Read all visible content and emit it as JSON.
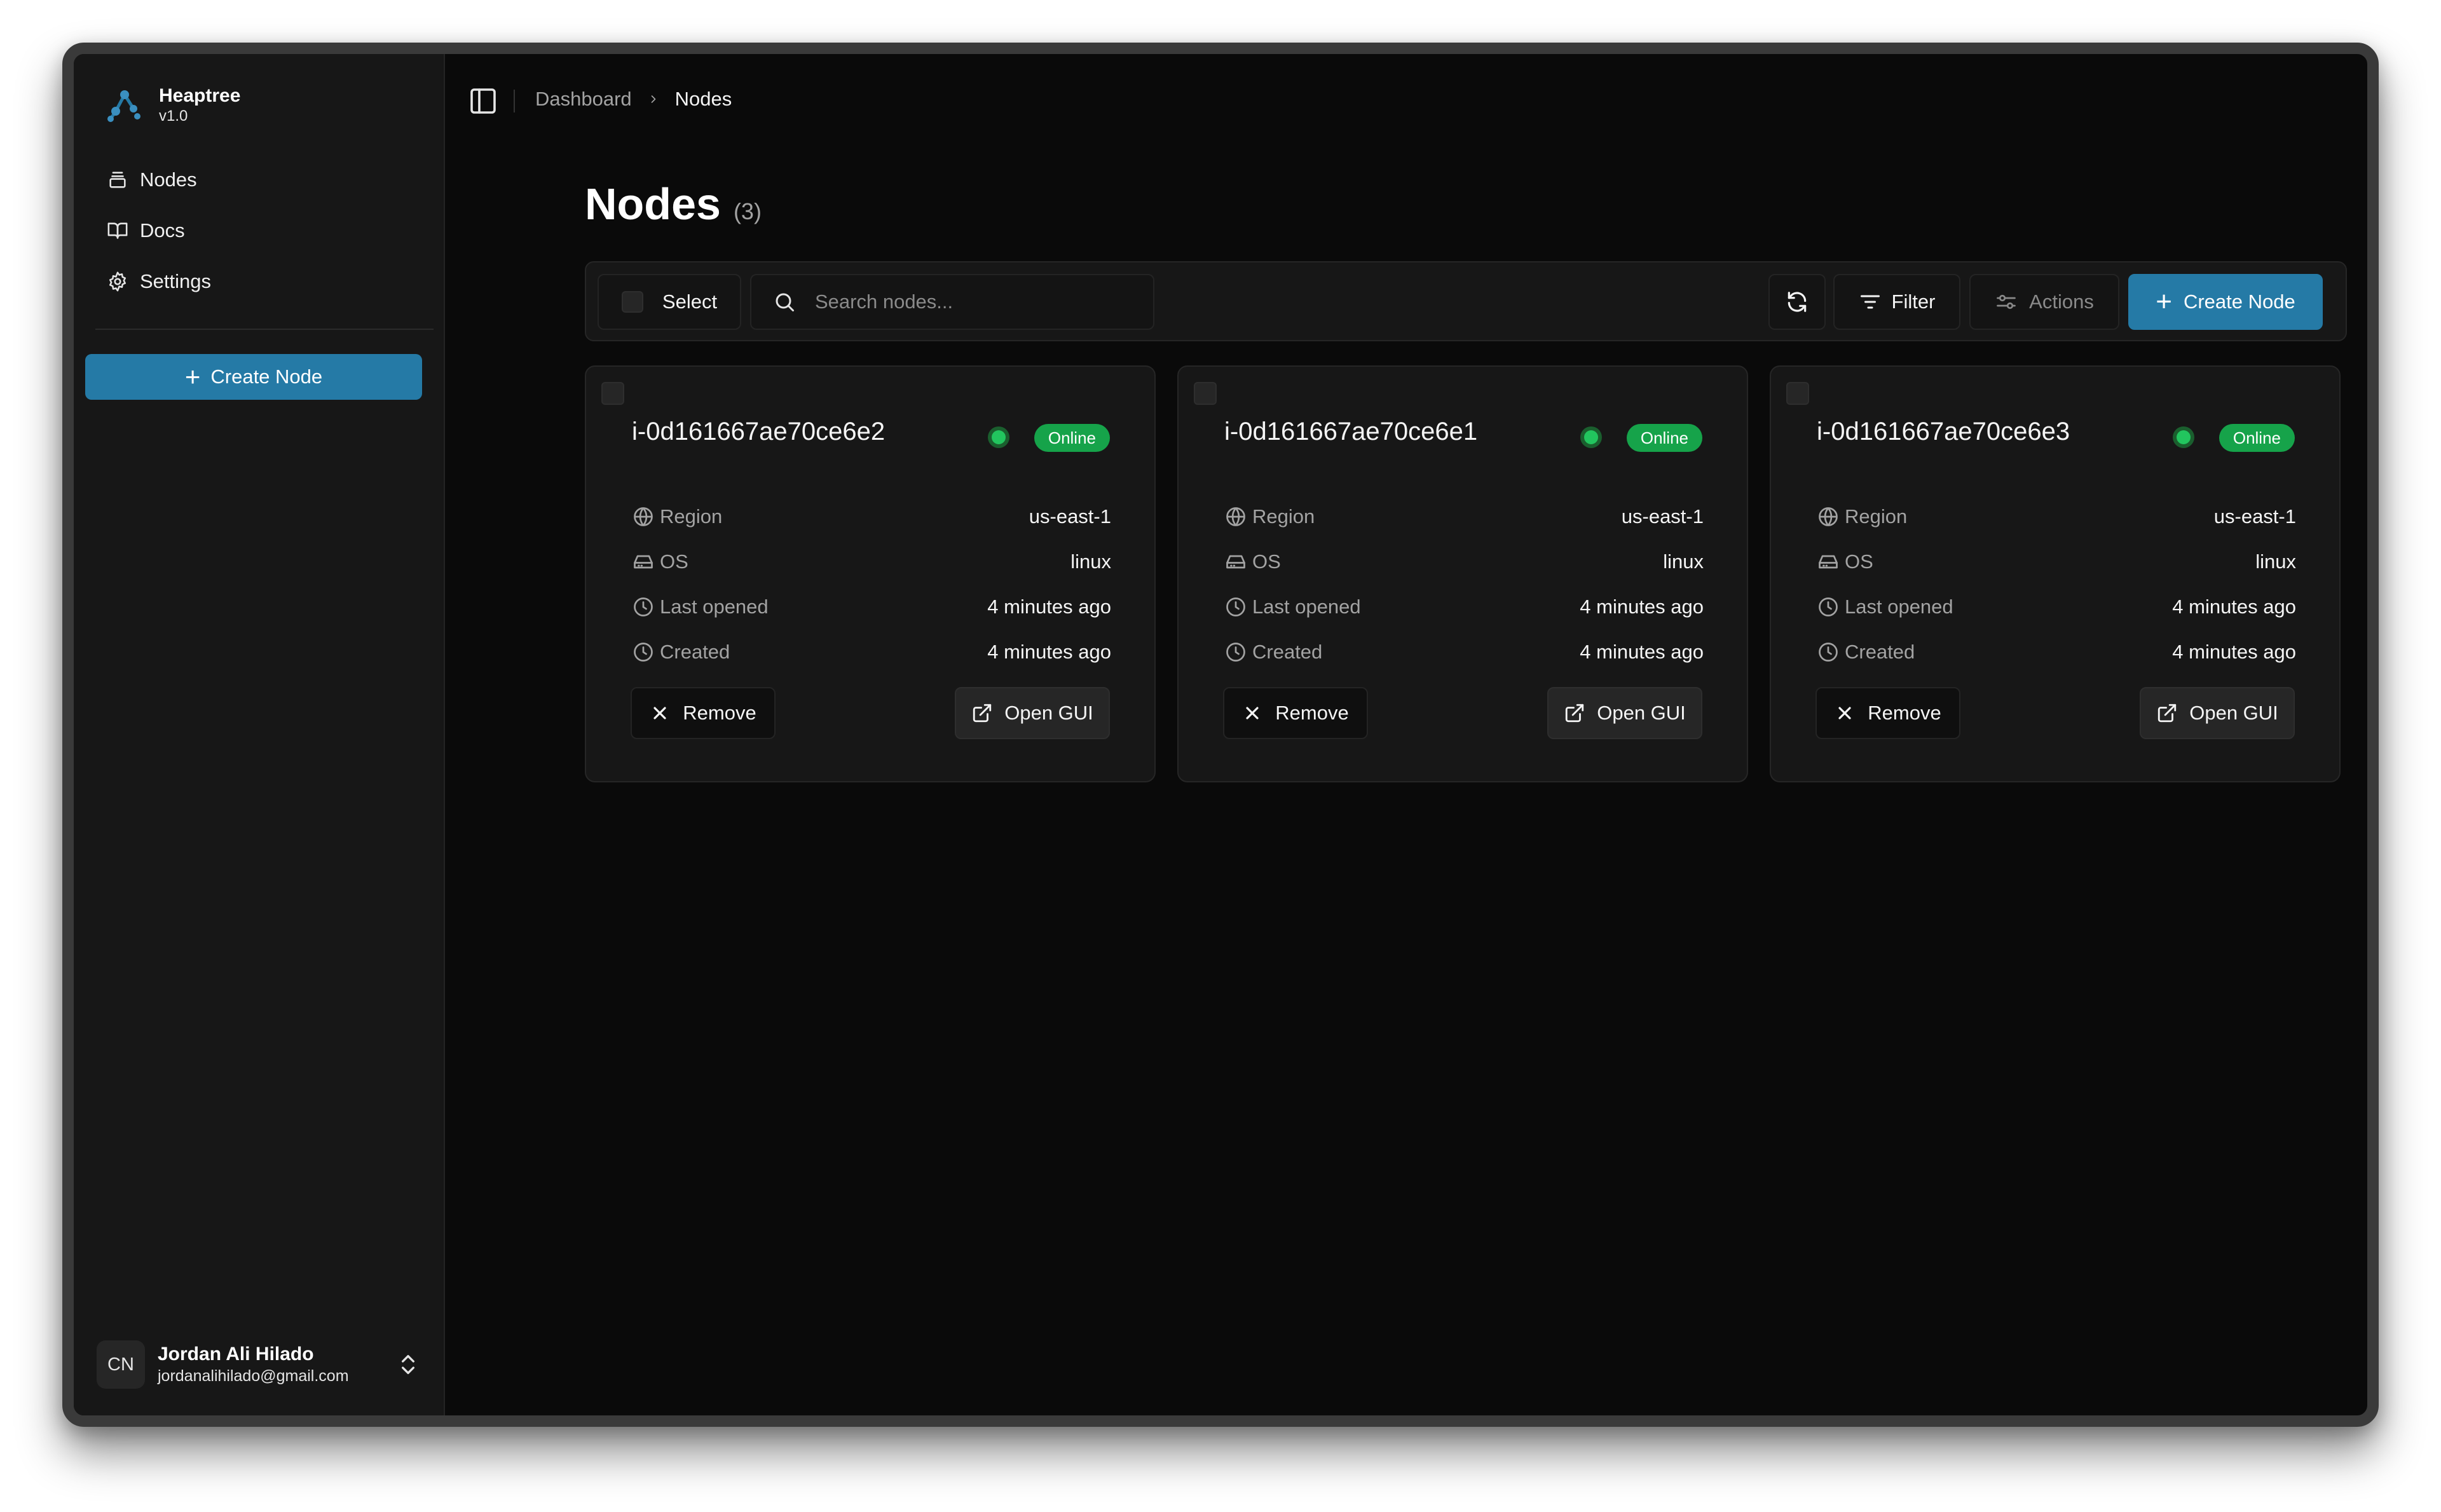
{
  "app": {
    "name": "Heaptree",
    "version": "v1.0"
  },
  "sidebar": {
    "items": [
      {
        "label": "Nodes",
        "icon": "server-icon"
      },
      {
        "label": "Docs",
        "icon": "book-icon"
      },
      {
        "label": "Settings",
        "icon": "gear-icon"
      }
    ],
    "create_label": "Create Node"
  },
  "user": {
    "initials": "CN",
    "name": "Jordan Ali Hilado",
    "email": "jordanalihilado@gmail.com"
  },
  "breadcrumb": {
    "parent": "Dashboard",
    "current": "Nodes"
  },
  "page": {
    "title": "Nodes",
    "count": "(3)"
  },
  "toolbar": {
    "select_label": "Select",
    "search_placeholder": "Search nodes...",
    "filter_label": "Filter",
    "actions_label": "Actions",
    "create_label": "Create Node"
  },
  "labels": {
    "region": "Region",
    "os": "OS",
    "last_opened": "Last opened",
    "created": "Created"
  },
  "nodes": [
    {
      "id": "i-0d161667ae70ce6e2",
      "status": "Online",
      "region": "us-east-1",
      "os": "linux",
      "last_opened": "4 minutes ago",
      "created": "4 minutes ago",
      "remove_label": "Remove",
      "open_label": "Open GUI"
    },
    {
      "id": "i-0d161667ae70ce6e1",
      "status": "Online",
      "region": "us-east-1",
      "os": "linux",
      "last_opened": "4 minutes ago",
      "created": "4 minutes ago",
      "remove_label": "Remove",
      "open_label": "Open GUI"
    },
    {
      "id": "i-0d161667ae70ce6e3",
      "status": "Online",
      "region": "us-east-1",
      "os": "linux",
      "last_opened": "4 minutes ago",
      "created": "4 minutes ago",
      "remove_label": "Remove",
      "open_label": "Open GUI"
    }
  ],
  "colors": {
    "accent": "#257aa6",
    "online": "#16a34a",
    "background": "#0a0a0a",
    "sidebar": "#171717"
  }
}
